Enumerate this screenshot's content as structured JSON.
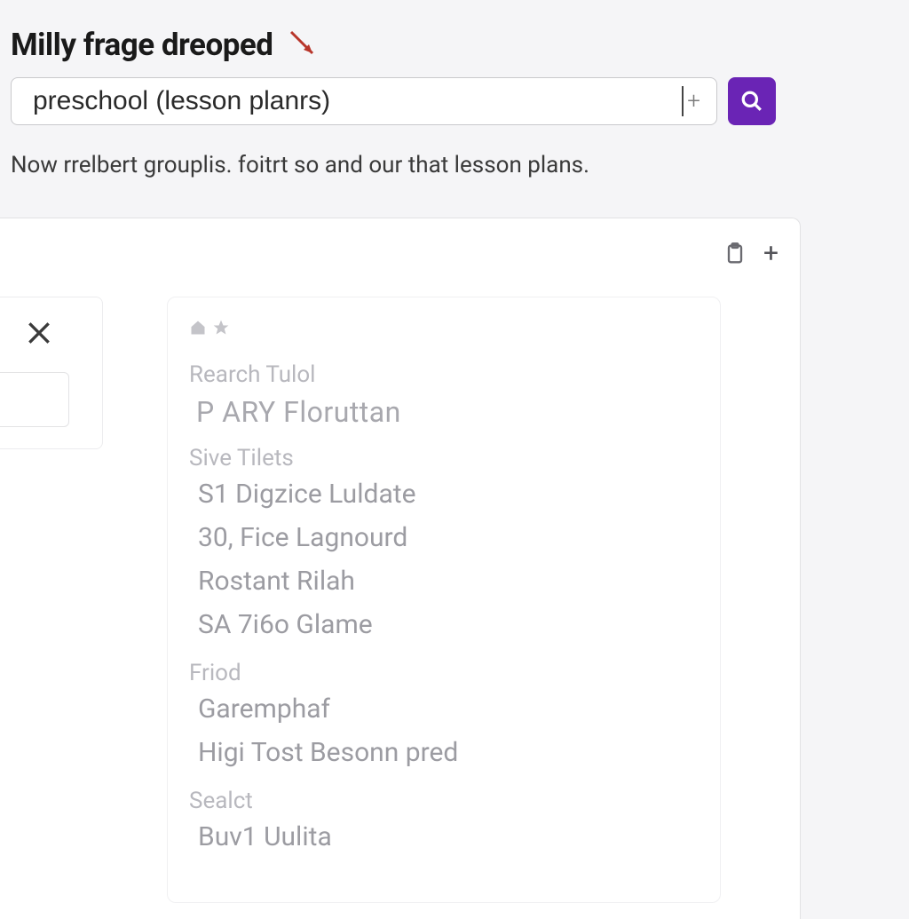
{
  "header": {
    "title": "Milly frage dreoped",
    "search_value": "preschool (lesson planrs)",
    "helper": "Now rrelbert grouplis. foitrt so and our that lesson plans."
  },
  "results": {
    "section1_label": "Rearch Tulol",
    "section1_heading": "P ARY Floruttan",
    "section2_label": "Sive Tilets",
    "items2": [
      "S1 Digzice Luldate",
      "30, Fice Lagnourd",
      "Rostant Rilah",
      "SA 7i6o Glame"
    ],
    "section3_label": "Friod",
    "items3": [
      "Garemphaf",
      "Higi Tost Besonn pred"
    ],
    "section4_label": "Sealct",
    "items4": [
      "Buv1 Uulita"
    ]
  },
  "colors": {
    "accent": "#6a24b5",
    "arrow": "#c0392b"
  }
}
